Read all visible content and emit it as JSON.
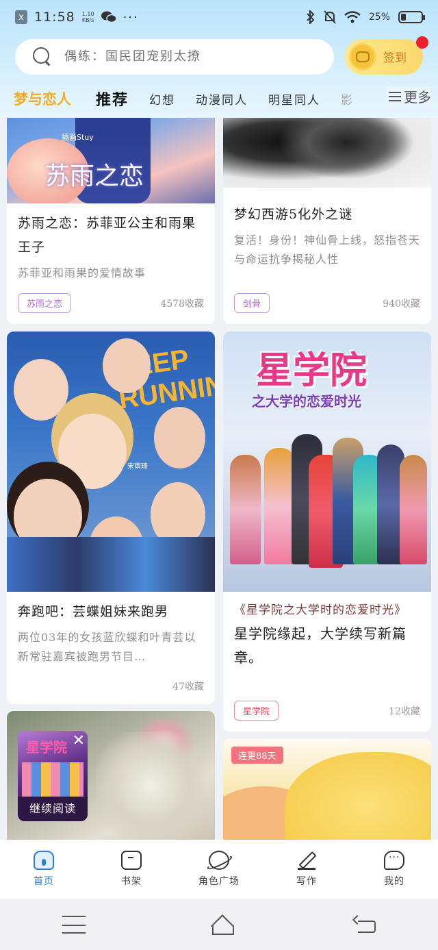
{
  "status_bar": {
    "x_badge": "x",
    "time": "11:58",
    "speed_value": "1.10",
    "speed_unit": "KB/s",
    "dots": "···",
    "battery_text": "25%",
    "battery_level": 0.25
  },
  "search": {
    "placeholder": "偶练：国民团宠别太撩",
    "signin_label": "签到"
  },
  "tabs": {
    "brand": "梦与恋人",
    "items": [
      "推荐",
      "幻想",
      "动漫同人",
      "明星同人",
      "影"
    ],
    "more": "更多"
  },
  "cards": [
    {
      "title": "苏雨之恋：苏菲亚公主和雨果王子",
      "desc": "苏菲亚和雨果的爱情故事",
      "tag": "苏雨之恋",
      "favorites": "4578收藏",
      "cover_text": "苏雨之恋",
      "cover_sub": "插画Stuy"
    },
    {
      "title": "梦幻西游5化外之谜",
      "desc": "复活！身份！神仙骨上线，怒指苍天与命运抗争揭秘人性",
      "tag": "剑骨",
      "favorites": "940收藏"
    },
    {
      "title": "奔跑吧：芸蝶姐妹来跑男",
      "desc": "两位03年的女孩蓝欣蝶和叶青芸以新常驻嘉宾被跑男节目…",
      "favorites": "47收藏",
      "cover_text": "KEEP RUNNING",
      "cover_sub": "宋雨琦"
    },
    {
      "quote": "《星学院之大学时的恋爱时光》",
      "title": "星学院缘起，大学续写新篇章。",
      "tag": "星学院",
      "favorites": "12收藏",
      "cover_title": "星学院",
      "cover_sub": "之大学的恋爱时光"
    },
    {
      "badge": "连更88天"
    }
  ],
  "float_reader": {
    "label": "继续阅读",
    "close": "✕",
    "cover_text": "星学院"
  },
  "bottom_nav": {
    "items": [
      {
        "label": "首页",
        "icon": "home-icon"
      },
      {
        "label": "书架",
        "icon": "bookshelf-icon"
      },
      {
        "label": "角色广场",
        "icon": "planet-icon"
      },
      {
        "label": "写作",
        "icon": "pen-icon"
      },
      {
        "label": "我的",
        "icon": "chat-icon"
      }
    ]
  },
  "colors": {
    "accent": "#2e7fe0",
    "brand": "#f1ad24",
    "tag_purple": "#b36ad8",
    "tag_red": "#e84f5c"
  }
}
